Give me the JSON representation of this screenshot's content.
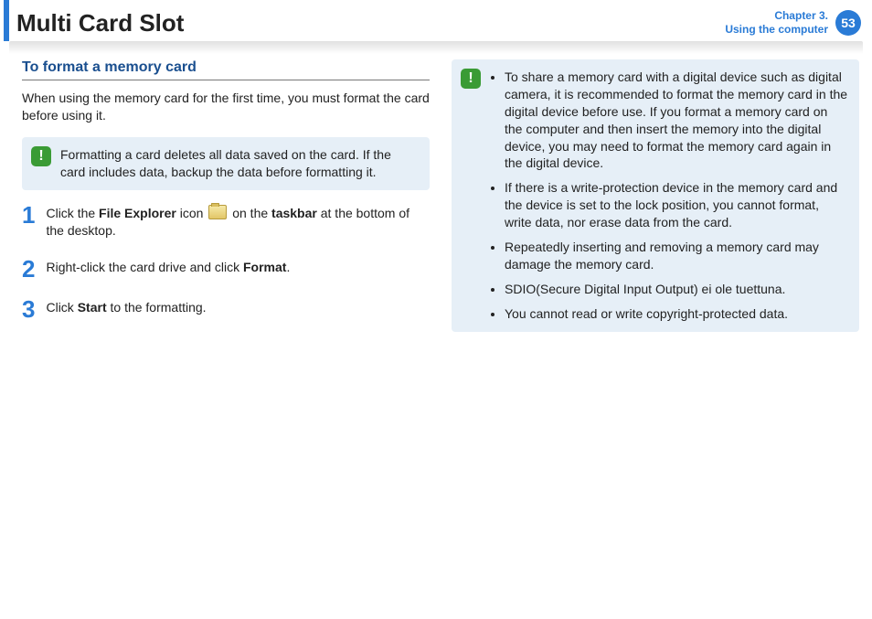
{
  "header": {
    "title": "Multi Card Slot",
    "chapter_line1": "Chapter 3.",
    "chapter_line2": "Using the computer",
    "page_number": "53"
  },
  "left": {
    "section_heading": "To format a memory card",
    "intro": "When using the memory card for the first time, you must format the card before using it.",
    "note": "Formatting a card deletes all data saved on the card. If the card includes data, backup the data before formatting it.",
    "steps": [
      {
        "num": "1",
        "pre": "Click the ",
        "b1": "File Explorer",
        "mid": " icon ",
        "b2": "taskbar",
        "post": " at the bottom of the desktop.",
        "connector": " on the "
      },
      {
        "num": "2",
        "pre": "Right-click the card drive and click ",
        "b1": "Format",
        "post": "."
      },
      {
        "num": "3",
        "pre": "Click ",
        "b1": "Start",
        "post": " to the formatting."
      }
    ]
  },
  "right": {
    "bullets": [
      "To share a memory card with a digital device such as digital camera, it is recommended to format the memory card in the digital device before use. If you format a memory card on the computer and then insert the memory into the digital device, you may need to format the memory card again in the digital device.",
      "If there is a write-protection device in the memory card and the device is set to the lock position, you cannot format, write data, nor erase data from the card.",
      "Repeatedly inserting and removing a memory card may damage the memory card.",
      "SDIO(Secure Digital Input Output) ei ole tuettuna.",
      "You cannot read or write copyright-protected data."
    ]
  }
}
